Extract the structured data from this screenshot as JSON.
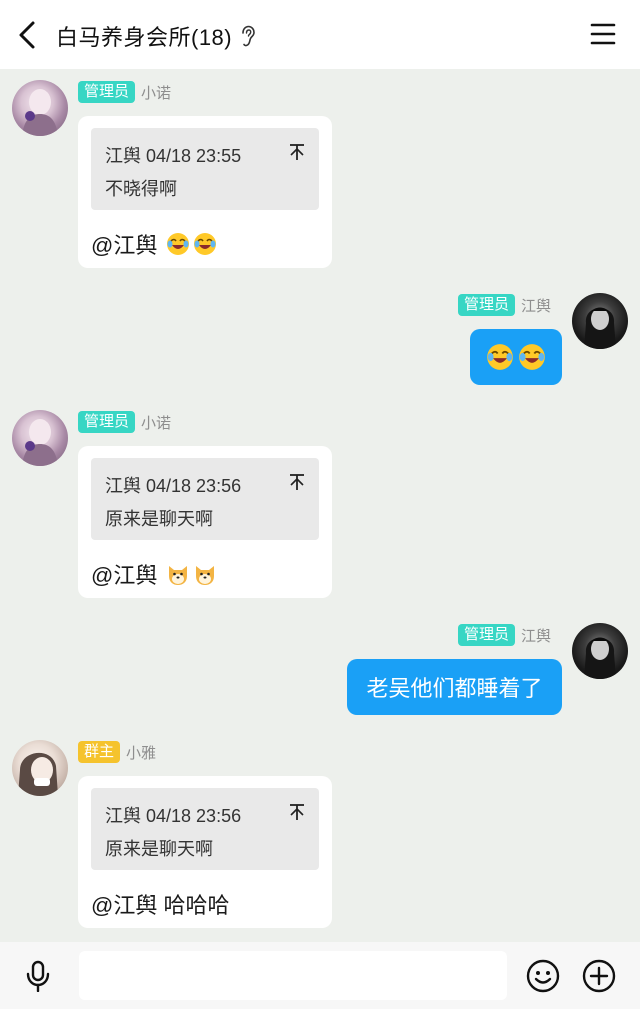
{
  "header": {
    "title": "白马养身会所(18)",
    "back_icon": "chevron-left-icon",
    "listen_icon": "ear-icon",
    "menu_icon": "hamburger-menu-icon"
  },
  "messages": [
    {
      "side": "left",
      "avatar": "avatar-xiaonuo",
      "badge": "管理员",
      "nickname": "小诺",
      "quote": {
        "author_time": "江舆 04/18 23:55",
        "text": "不晓得啊"
      },
      "reply_text": "@江舆",
      "emojis": [
        "laughing-tears-emoji",
        "laughing-tears-emoji"
      ]
    },
    {
      "side": "right",
      "avatar": "avatar-jiangyu",
      "badge": "管理员",
      "nickname": "江舆",
      "emojis": [
        "laughing-tears-emoji",
        "laughing-tears-emoji"
      ]
    },
    {
      "side": "left",
      "avatar": "avatar-xiaonuo",
      "badge": "管理员",
      "nickname": "小诺",
      "quote": {
        "author_time": "江舆 04/18 23:56",
        "text": "原来是聊天啊"
      },
      "reply_text": "@江舆",
      "emojis": [
        "shiba-dog-emoji",
        "shiba-dog-emoji"
      ]
    },
    {
      "side": "right",
      "avatar": "avatar-jiangyu",
      "badge": "管理员",
      "nickname": "江舆",
      "text": "老吴他们都睡着了"
    },
    {
      "side": "left",
      "avatar": "avatar-xiaoya",
      "badge": "群主",
      "nickname": "小雅",
      "quote": {
        "author_time": "江舆 04/18 23:56",
        "text": "原来是聊天啊"
      },
      "reply_text": "@江舆 哈哈哈"
    }
  ],
  "input_bar": {
    "mic_icon": "microphone-icon",
    "placeholder": "",
    "emoji_icon": "smiley-face-icon",
    "plus_icon": "plus-circle-icon"
  },
  "colors": {
    "admin_badge": "#37d6c4",
    "owner_badge": "#f5c32d",
    "outgoing_bubble": "#1aa0f6",
    "chat_background": "#edf0ec"
  }
}
